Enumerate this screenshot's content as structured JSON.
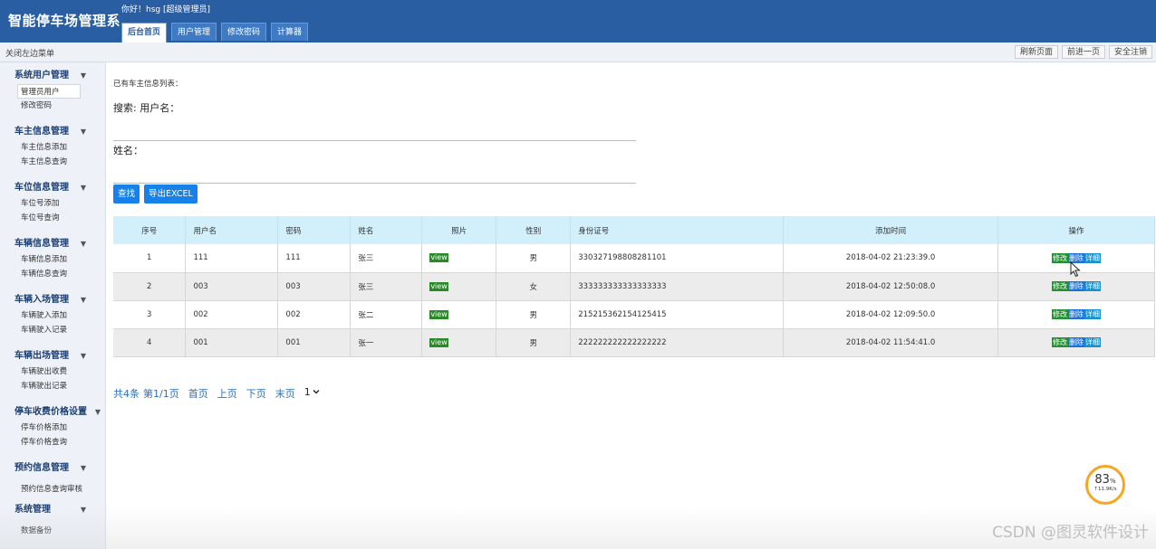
{
  "header": {
    "app_title": "智能停车场管理系",
    "greeting": "你好！hsg [超级管理员]",
    "tabs": [
      {
        "label": "后台首页"
      },
      {
        "label": "用户管理"
      },
      {
        "label": "修改密码"
      },
      {
        "label": "计算器"
      }
    ]
  },
  "toolbar": {
    "close_menu": "关闭左边菜单",
    "buttons": [
      {
        "label": "刷新页面"
      },
      {
        "label": "前进一页"
      },
      {
        "label": "安全注销"
      }
    ]
  },
  "sidebar": {
    "groups": [
      {
        "title": "系统用户管理",
        "items": [
          "管理员用户",
          "修改密码"
        ]
      },
      {
        "title": "车主信息管理",
        "items": [
          "车主信息添加",
          "车主信息查询"
        ]
      },
      {
        "title": "车位信息管理",
        "items": [
          "车位号添加",
          "车位号查询"
        ]
      },
      {
        "title": "车辆信息管理",
        "items": [
          "车辆信息添加",
          "车辆信息查询"
        ]
      },
      {
        "title": "车辆入场管理",
        "items": [
          "车辆驶入添加",
          "车辆驶入记录"
        ]
      },
      {
        "title": "车辆出场管理",
        "items": [
          "车辆驶出收费",
          "车辆驶出记录"
        ]
      },
      {
        "title": "停车收费价格设置",
        "items": [
          "停车价格添加",
          "停车价格查询"
        ]
      },
      {
        "title": "预约信息管理",
        "items": [
          "预约信息查询审核"
        ]
      },
      {
        "title": "系统管理",
        "items": [
          "数据备份"
        ]
      }
    ],
    "chevron": "▼"
  },
  "main": {
    "list_caption": "已有车主信息列表：",
    "search_label": "搜索: 用户名：",
    "search_value": "",
    "name_label": "姓名：",
    "name_value": "",
    "search_button": "查找",
    "export_button": "导出EXCEL"
  },
  "table": {
    "headers": [
      "序号",
      "用户名",
      "密码",
      "姓名",
      "照片",
      "性别",
      "身份证号",
      "添加时间",
      "操作"
    ],
    "rows": [
      {
        "no": "1",
        "username": "111",
        "password": "111",
        "name": "张三",
        "photo": "view",
        "gender": "男",
        "id_card": "330327198808281101",
        "added": "2018-04-02 21:23:39.0"
      },
      {
        "no": "2",
        "username": "003",
        "password": "003",
        "name": "张三",
        "photo": "view",
        "gender": "女",
        "id_card": "333333333333333333",
        "added": "2018-04-02 12:50:08.0"
      },
      {
        "no": "3",
        "username": "002",
        "password": "002",
        "name": "张二",
        "photo": "view",
        "gender": "男",
        "id_card": "215215362154125415",
        "added": "2018-04-02 12:09:50.0"
      },
      {
        "no": "4",
        "username": "001",
        "password": "001",
        "name": "张一",
        "photo": "view",
        "gender": "男",
        "id_card": "222222222222222222",
        "added": "2018-04-02 11:54:41.0"
      }
    ],
    "actions": {
      "edit": "修改",
      "delete": "删除",
      "detail": "详细"
    }
  },
  "pager": {
    "total": "共4条",
    "page_info": "第1/1页",
    "first": "首页",
    "prev": "上页",
    "next": "下页",
    "last": "末页",
    "page_select": "1"
  },
  "speed_widget": {
    "percent": "83",
    "percent_unit": "%",
    "rate": "↑11.9K/s"
  },
  "watermark": "CSDN @图灵软件设计",
  "colors": {
    "header": "#2a5ea3",
    "table_head": "#d2f0fb",
    "button": "#1681e8"
  }
}
